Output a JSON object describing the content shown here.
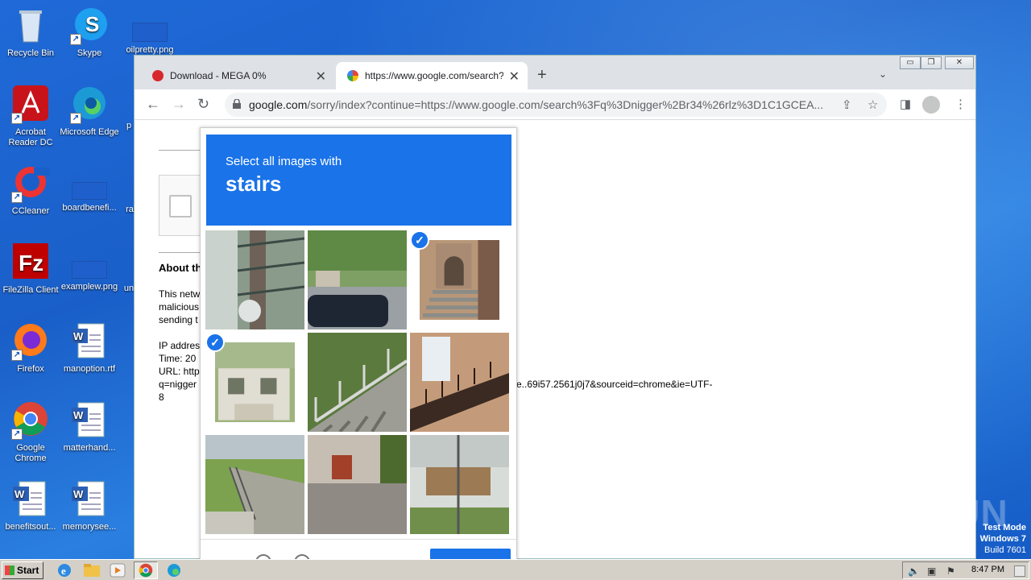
{
  "desktop": {
    "icons": [
      {
        "label": "Recycle Bin",
        "icon": "recycle-bin-icon"
      },
      {
        "label": "Skype",
        "icon": "skype-icon"
      },
      {
        "label": "oilpretty.png",
        "icon": "image-file-icon"
      },
      {
        "label": "Acrobat Reader DC",
        "icon": "acrobat-icon"
      },
      {
        "label": "Microsoft Edge",
        "icon": "edge-icon"
      },
      {
        "label": "p",
        "icon": "file-icon"
      },
      {
        "label": "CCleaner",
        "icon": "ccleaner-icon"
      },
      {
        "label": "boardbenefi...",
        "icon": "file-icon"
      },
      {
        "label": "ra",
        "icon": "file-icon"
      },
      {
        "label": "FileZilla Client",
        "icon": "filezilla-icon"
      },
      {
        "label": "examplew.png",
        "icon": "image-file-icon"
      },
      {
        "label": "un",
        "icon": "file-icon"
      },
      {
        "label": "Firefox",
        "icon": "firefox-icon"
      },
      {
        "label": "manoption.rtf",
        "icon": "word-doc-icon"
      },
      {
        "label": "Google Chrome",
        "icon": "chrome-icon"
      },
      {
        "label": "matterhand...",
        "icon": "word-doc-icon"
      },
      {
        "label": "benefitsout...",
        "icon": "word-doc-icon"
      },
      {
        "label": "memorysee...",
        "icon": "word-doc-icon"
      }
    ]
  },
  "browser": {
    "tabs": [
      {
        "title": "Download - MEGA 0%",
        "active": false
      },
      {
        "title": "https://www.google.com/search?q=",
        "active": true
      }
    ],
    "url_host": "google.com",
    "url_rest": "/sorry/index?continue=https://www.google.com/search%3Fq%3Dnigger%2Br34%26rlz%3D1C1GCEA...",
    "window_controls": {
      "minimize": "▭",
      "restore": "❐",
      "close": "✕"
    }
  },
  "page": {
    "about_heading": "About th",
    "text_lines": [
      "This netw",
      "malicious",
      "sending t"
    ],
    "ip_line": "IP addres",
    "time_line": "Time: 20",
    "url_line": "URL: http",
    "q_line": "q=nigger",
    "url_tail": "e..69i57.2561j0j7&sourceid=chrome&ie=UTF-",
    "last_line": "8"
  },
  "captcha": {
    "instruction": "Select all images with",
    "target": "stairs",
    "tiles": [
      {
        "selected": false
      },
      {
        "selected": false
      },
      {
        "selected": true
      },
      {
        "selected": true
      },
      {
        "selected": false
      },
      {
        "selected": false
      },
      {
        "selected": false
      },
      {
        "selected": false
      },
      {
        "selected": false
      }
    ]
  },
  "watermark": {
    "brand": "ANY RUN",
    "mode": "Test Mode",
    "os": "Windows 7",
    "build": "Build 7601"
  },
  "taskbar": {
    "start_label": "Start",
    "clock": "8:47 PM"
  }
}
